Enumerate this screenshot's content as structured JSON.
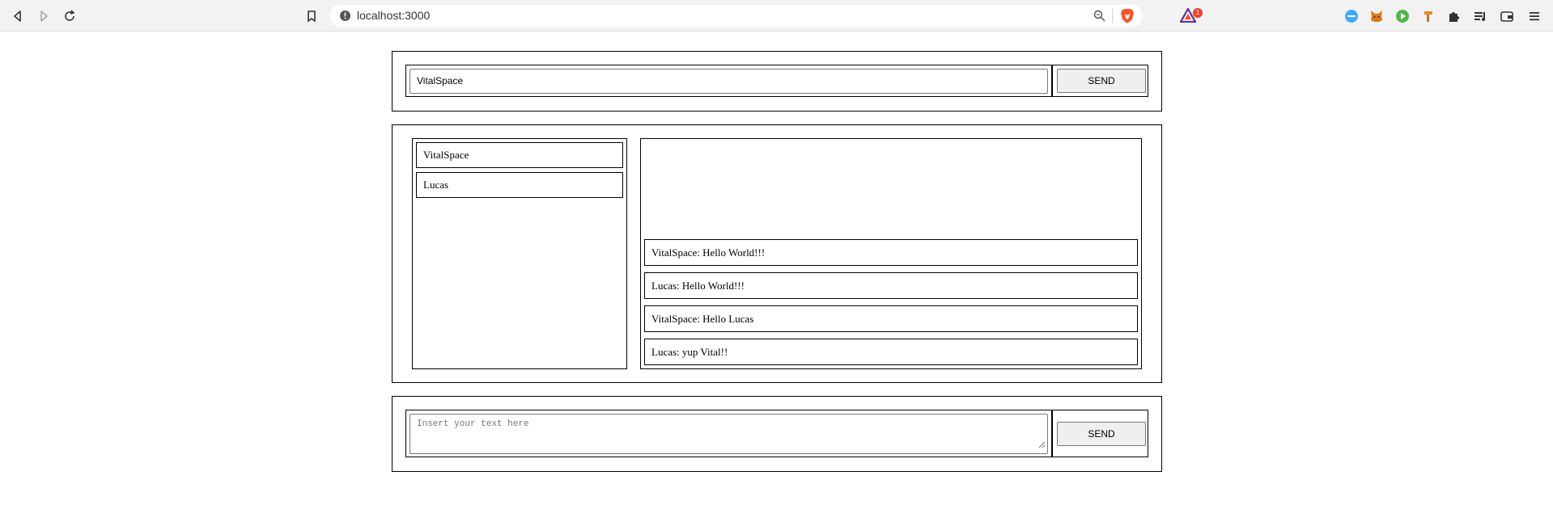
{
  "browser": {
    "url": "localhost:3000",
    "rewards_badge": "1",
    "icons": {
      "back": "back-arrow-icon",
      "forward": "forward-arrow-icon",
      "reload": "reload-icon",
      "bookmark": "bookmark-icon",
      "site_info": "info-icon",
      "zoom": "zoom-icon",
      "brave": "brave-shield-icon",
      "rewards": "brave-rewards-icon",
      "extensions": [
        "fps-extension-icon",
        "metamask-fox-icon",
        "play-extension-icon",
        "hammer-extension-icon",
        "puzzle-extensions-icon",
        "playlist-icon",
        "wallet-icon",
        "menu-icon"
      ]
    }
  },
  "login": {
    "name_value": "VitalSpace",
    "send_label": "SEND"
  },
  "users": [
    "VitalSpace",
    "Lucas"
  ],
  "messages": [
    "VitalSpace: Hello World!!!",
    "Lucas: Hello World!!!",
    "VitalSpace: Hello Lucas",
    "Lucas: yup Vital!!"
  ],
  "composer": {
    "placeholder": "Insert your text here",
    "send_label": "SEND"
  },
  "colors": {
    "border": "#000000",
    "button_bg": "#efefef",
    "chrome_bg": "#f2f2f2",
    "badge": "#e8442b"
  }
}
